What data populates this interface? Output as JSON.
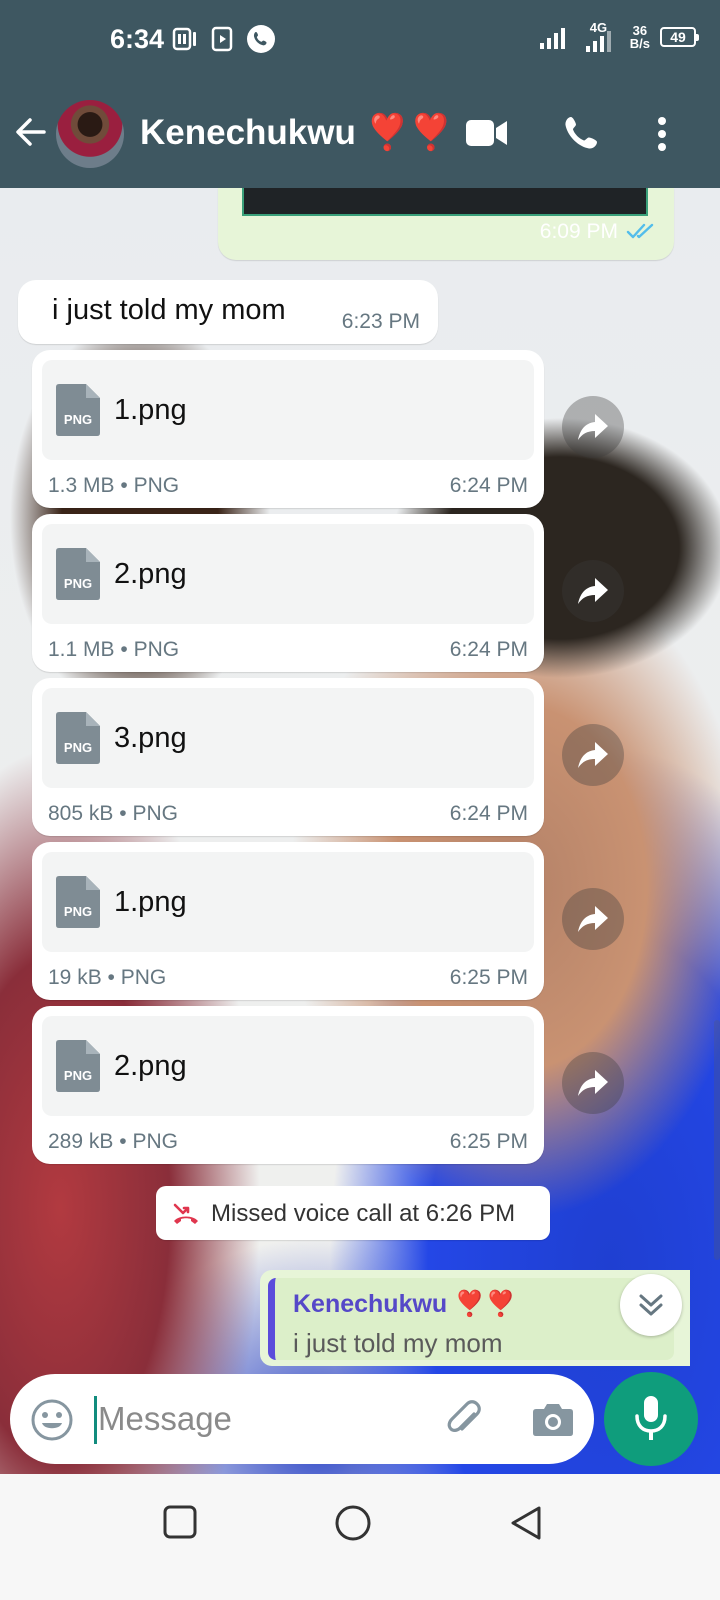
{
  "status_bar": {
    "time": "6:34",
    "network": "4G",
    "speed_value": "36",
    "speed_unit": "B/s",
    "battery": "49"
  },
  "header": {
    "contact_name": "Kenechukwu ❣️❣️",
    "icons": [
      "back-arrow-icon",
      "video-call-icon",
      "voice-call-icon",
      "more-options-icon"
    ]
  },
  "chat": {
    "sent_partial": {
      "time": "6:09 PM",
      "status": "read"
    },
    "text_message": {
      "text": "i just told my mom",
      "time": "6:23 PM"
    },
    "files": [
      {
        "name": "1.png",
        "size": "1.3 MB",
        "type": "PNG",
        "time": "6:24 PM",
        "badge": "PNG"
      },
      {
        "name": "2.png",
        "size": "1.1 MB",
        "type": "PNG",
        "time": "6:24 PM",
        "badge": "PNG"
      },
      {
        "name": "3.png",
        "size": "805 kB",
        "type": "PNG",
        "time": "6:24 PM",
        "badge": "PNG"
      },
      {
        "name": "1.png",
        "size": "19 kB",
        "type": "PNG",
        "time": "6:25 PM",
        "badge": "PNG"
      },
      {
        "name": "2.png",
        "size": "289 kB",
        "type": "PNG",
        "time": "6:25 PM",
        "badge": "PNG"
      }
    ],
    "meta_separator": "•",
    "missed_call": "Missed voice call at 6:26 PM",
    "reply_preview": {
      "name": "Kenechukwu ❣️❣️",
      "text": "i just told my mom"
    }
  },
  "input": {
    "placeholder": "Message",
    "value": ""
  },
  "colors": {
    "header_bg": "#3e5761",
    "sent_bubble": "#e7f5d8",
    "accent_green": "#0f9d7c",
    "reply_bar": "#5b4cdb",
    "missed_red": "#e0364e"
  }
}
